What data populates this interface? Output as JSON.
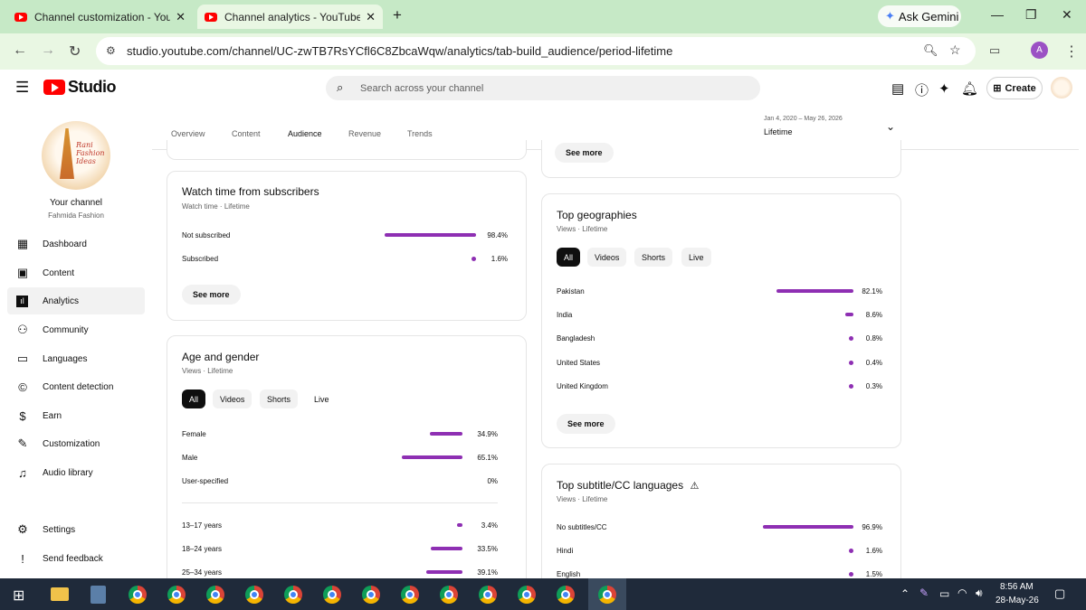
{
  "browser": {
    "tabs": [
      {
        "title": "Channel customization - YouTu",
        "close": "✕"
      },
      {
        "title": "Channel analytics - YouTube St",
        "close": "✕"
      }
    ],
    "new_tab": "+",
    "gemini_label": "Ask Gemini",
    "url": "studio.youtube.com/channel/UC-zwTB7RsYCfl6C8ZbcaWqw/analytics/tab-build_audience/period-lifetime",
    "profile_initial": "A"
  },
  "header": {
    "logo_text": "Studio",
    "search_placeholder": "Search across your channel",
    "create_label": "Create"
  },
  "sidebar": {
    "channel_label": "Your channel",
    "channel_name": "Fahmida Fashion",
    "avatar_text": [
      "Rani",
      "Fashion",
      "Ideas"
    ],
    "items": [
      {
        "label": "Dashboard",
        "icon": "dashboard-icon"
      },
      {
        "label": "Content",
        "icon": "content-icon"
      },
      {
        "label": "Analytics",
        "icon": "analytics-icon"
      },
      {
        "label": "Community",
        "icon": "community-icon"
      },
      {
        "label": "Languages",
        "icon": "languages-icon"
      },
      {
        "label": "Content detection",
        "icon": "content-detection-icon"
      },
      {
        "label": "Earn",
        "icon": "earn-icon"
      },
      {
        "label": "Customization",
        "icon": "customization-icon"
      },
      {
        "label": "Audio library",
        "icon": "audio-library-icon"
      }
    ],
    "bottom": [
      {
        "label": "Settings",
        "icon": "settings-icon"
      },
      {
        "label": "Send feedback",
        "icon": "feedback-icon"
      }
    ]
  },
  "analytics": {
    "tabs": [
      "Overview",
      "Content",
      "Audience",
      "Revenue",
      "Trends"
    ],
    "selected_tab": "Audience",
    "period_range": "Jan 4, 2020 – May 26, 2026",
    "period_label": "Lifetime"
  },
  "see_more": "See more",
  "chips": [
    "All",
    "Videos",
    "Shorts",
    "Live"
  ],
  "watch_time_subs": {
    "title": "Watch time from subscribers",
    "subtitle": "Watch time · Lifetime",
    "rows": [
      {
        "label": "Not subscribed",
        "value": "98.4%",
        "pct": 98.4
      },
      {
        "label": "Subscribed",
        "value": "1.6%",
        "pct": 1.6
      }
    ]
  },
  "age_gender": {
    "title": "Age and gender",
    "subtitle": "Views · Lifetime",
    "gender_rows": [
      {
        "label": "Female",
        "value": "34.9%",
        "pct": 34.9
      },
      {
        "label": "Male",
        "value": "65.1%",
        "pct": 65.1
      },
      {
        "label": "User-specified",
        "value": "0%",
        "pct": 0
      }
    ],
    "age_rows": [
      {
        "label": "13–17 years",
        "value": "3.4%",
        "pct": 3.4
      },
      {
        "label": "18–24 years",
        "value": "33.5%",
        "pct": 33.5
      },
      {
        "label": "25–34 years",
        "value": "39.1%",
        "pct": 39.1
      }
    ]
  },
  "top_geo": {
    "title": "Top geographies",
    "subtitle": "Views · Lifetime",
    "rows": [
      {
        "label": "Pakistan",
        "value": "82.1%",
        "pct": 82.1
      },
      {
        "label": "India",
        "value": "8.6%",
        "pct": 8.6
      },
      {
        "label": "Bangladesh",
        "value": "0.8%",
        "pct": 0.8
      },
      {
        "label": "United States",
        "value": "0.4%",
        "pct": 0.4
      },
      {
        "label": "United Kingdom",
        "value": "0.3%",
        "pct": 0.3
      }
    ]
  },
  "top_subtitles": {
    "title": "Top subtitle/CC languages",
    "subtitle": "Views · Lifetime",
    "rows": [
      {
        "label": "No subtitles/CC",
        "value": "96.9%",
        "pct": 96.9
      },
      {
        "label": "Hindi",
        "value": "1.6%",
        "pct": 1.6
      },
      {
        "label": "English",
        "value": "1.5%",
        "pct": 1.5
      }
    ]
  },
  "taskbar": {
    "time": "8:56 AM",
    "date": "28-May-26"
  },
  "colors": {
    "bar": "#8e2fb3",
    "chrome_tabbar": "#c6e9c6",
    "chrome_toolbar": "#e9f7e3",
    "taskbar": "#1f2a3a"
  }
}
